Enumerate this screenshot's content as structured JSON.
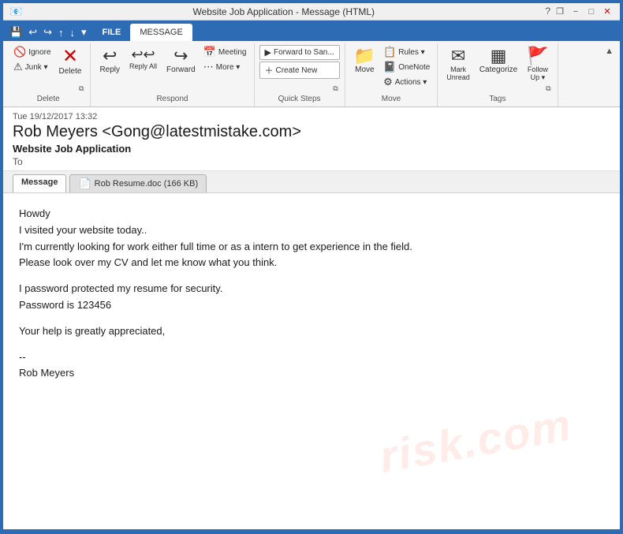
{
  "window": {
    "title": "Website Job Application - Message (HTML)",
    "controls": {
      "help": "?",
      "restore": "❐",
      "minimize": "−",
      "maximize": "□",
      "close": "✕"
    }
  },
  "ribbon": {
    "tabs": [
      {
        "id": "file",
        "label": "FILE"
      },
      {
        "id": "message",
        "label": "MESSAGE",
        "active": true
      }
    ],
    "groups": {
      "delete": {
        "label": "Delete",
        "buttons": [
          {
            "id": "ignore",
            "icon": "🚫",
            "label": "Ignore"
          },
          {
            "id": "delete",
            "icon": "✕",
            "label": "Delete"
          },
          {
            "id": "junk",
            "icon": "⚠",
            "label": "Junk ▾"
          }
        ]
      },
      "respond": {
        "label": "Respond",
        "buttons": [
          {
            "id": "reply",
            "icon": "↩",
            "label": "Reply"
          },
          {
            "id": "reply-all",
            "icon": "↩↩",
            "label": "Reply All"
          },
          {
            "id": "forward",
            "icon": "↪",
            "label": "Forward"
          },
          {
            "id": "meeting",
            "icon": "📅",
            "label": "Meeting"
          },
          {
            "id": "more",
            "icon": "⋯",
            "label": "More ▾"
          }
        ]
      },
      "quicksteps": {
        "label": "Quick Steps",
        "items": [
          {
            "id": "forward-to-san",
            "label": "Forward to San..."
          },
          {
            "id": "create-new",
            "label": "Create New"
          }
        ]
      },
      "move": {
        "label": "Move",
        "buttons": [
          {
            "id": "rules",
            "icon": "📋",
            "label": "Rules ▾"
          },
          {
            "id": "onenote",
            "icon": "📓",
            "label": "OneNote"
          },
          {
            "id": "actions",
            "icon": "⚙",
            "label": "Actions ▾"
          },
          {
            "id": "move-btn",
            "icon": "📁",
            "label": "Move"
          }
        ]
      },
      "tags": {
        "label": "Tags",
        "buttons": [
          {
            "id": "mark-unread",
            "icon": "✉",
            "label": "Mark Unread"
          },
          {
            "id": "categorize",
            "icon": "🏷",
            "label": "Categorize"
          },
          {
            "id": "follow-up",
            "icon": "🚩",
            "label": "Follow Up ▾"
          }
        ]
      }
    }
  },
  "quick_access": {
    "buttons": [
      "💾",
      "←",
      "→",
      "↑",
      "↓",
      "⋯"
    ]
  },
  "email": {
    "date": "Tue 19/12/2017 13:32",
    "from": "Rob Meyers <Gong@latestmistake.com>",
    "subject": "Website Job Application",
    "to": "To",
    "tabs": [
      {
        "id": "message",
        "label": "Message",
        "active": true
      },
      {
        "id": "attachment",
        "label": "Rob Resume.doc (166 KB)",
        "hasIcon": true
      }
    ],
    "body": {
      "line1": "Howdy",
      "line2": "I visited your website today..",
      "line3": "I'm currently looking for work either full time or as a intern to get experience in the field.",
      "line4": "Please look over my CV and let me know what you think.",
      "line5": "",
      "line6": "I password protected my resume for security.",
      "line7": "Password is 123456",
      "line8": "",
      "line9": "Your help is greatly appreciated,",
      "line10": "",
      "line11": "--",
      "line12": "Rob Meyers"
    }
  },
  "watermark": "risk.com"
}
